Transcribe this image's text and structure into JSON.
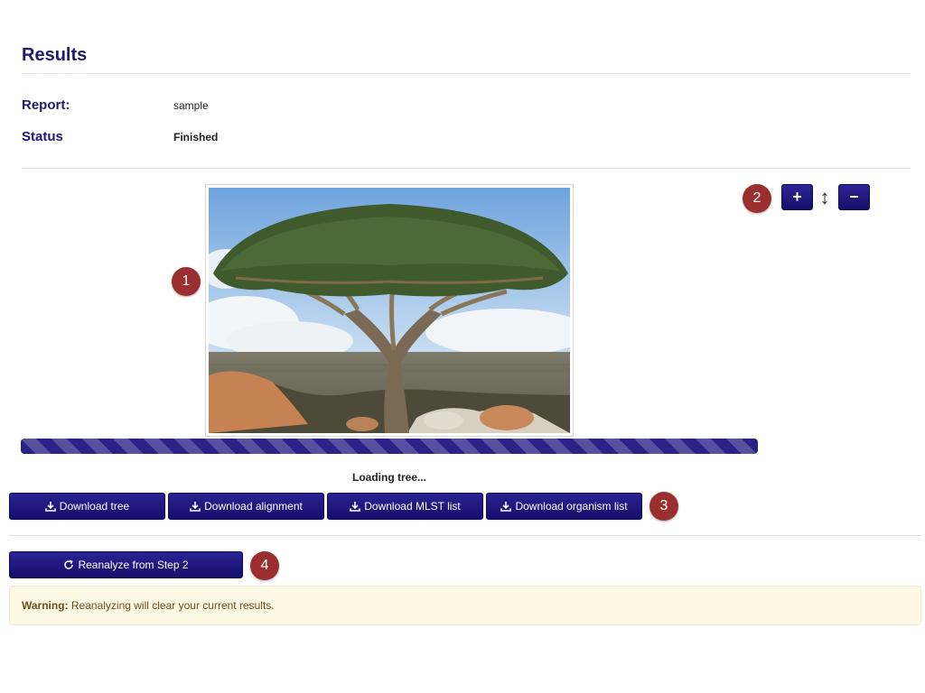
{
  "page": {
    "title": "Results"
  },
  "report": {
    "label": "Report:",
    "value": "sample"
  },
  "status": {
    "label": "Status",
    "value": "Finished"
  },
  "tree_viewer": {
    "image_description_icon": "dragon-blood-tree-image",
    "zoom_in_label": "+",
    "zoom_out_label": "−",
    "resize_symbol": "↕",
    "progress": 1.0,
    "loading_text": "Loading tree..."
  },
  "downloads": [
    {
      "label": "Download tree",
      "icon": "download-icon"
    },
    {
      "label": "Download alignment",
      "icon": "download-icon"
    },
    {
      "label": "Download MLST list",
      "icon": "download-icon"
    },
    {
      "label": "Download organism list",
      "icon": "download-icon"
    }
  ],
  "reanalyze": {
    "label": "Reanalyze from Step 2",
    "icon": "refresh-icon"
  },
  "warning": {
    "prefix": "Warning:",
    "text": " Reanalyzing will clear your current results."
  },
  "callouts": [
    "1",
    "2",
    "3",
    "4"
  ],
  "colors": {
    "primary": "#1f1a6e",
    "button": "#1c157a",
    "callout": "#9b2f2f",
    "warning_bg": "#fcf8e3"
  }
}
